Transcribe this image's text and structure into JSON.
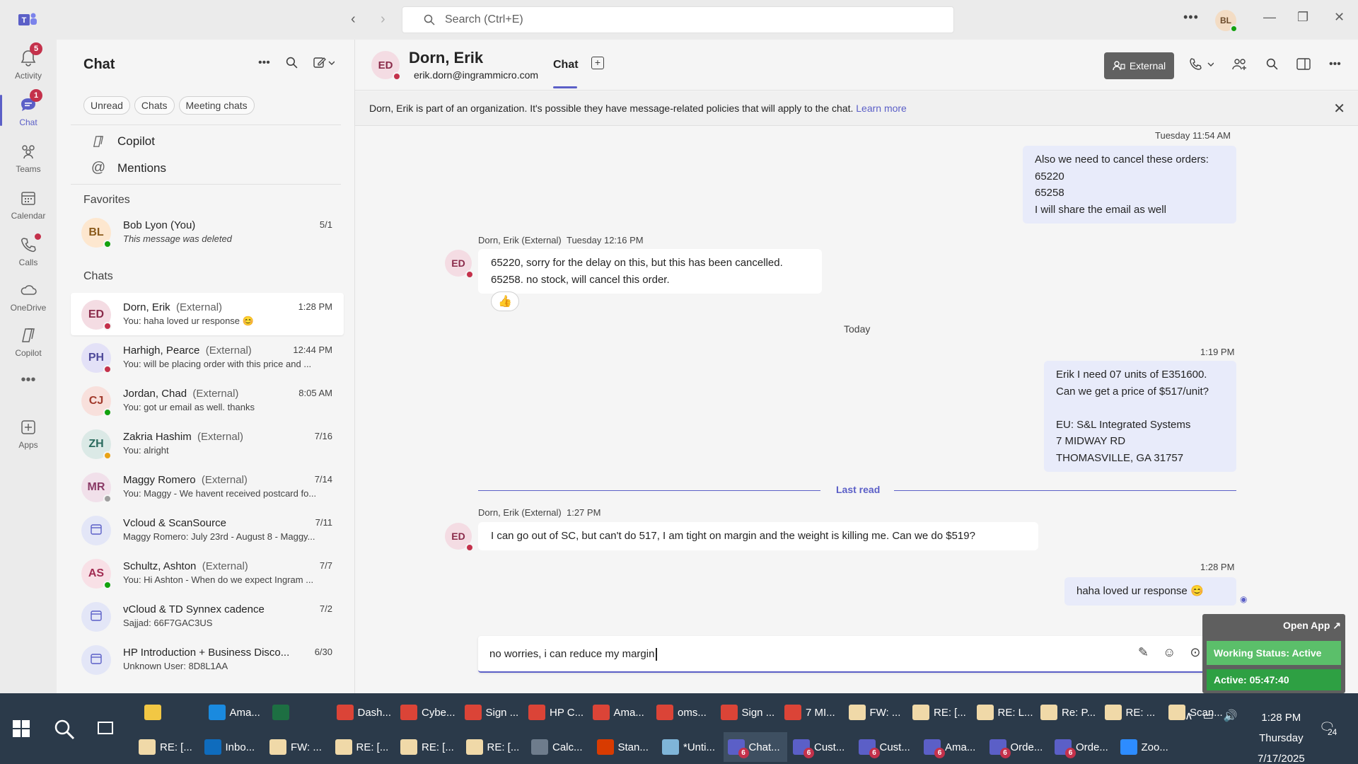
{
  "titlebar": {
    "search_placeholder": "Search (Ctrl+E)",
    "user_initials": "BL"
  },
  "rail": {
    "items": [
      {
        "label": "Activity",
        "badge": "5"
      },
      {
        "label": "Chat",
        "badge": "1"
      },
      {
        "label": "Teams"
      },
      {
        "label": "Calendar"
      },
      {
        "label": "Calls"
      },
      {
        "label": "OneDrive"
      },
      {
        "label": "Copilot"
      },
      {
        "label": "Apps"
      }
    ]
  },
  "chatlist": {
    "title": "Chat",
    "filters": [
      "Unread",
      "Chats",
      "Meeting chats"
    ],
    "copilot_label": "Copilot",
    "mentions_label": "Mentions",
    "favorites_label": "Favorites",
    "chats_label": "Chats",
    "favorites": [
      {
        "initials": "BL",
        "name": "Bob Lyon (You)",
        "ext": "",
        "time": "5/1",
        "preview": "This message was deleted",
        "bg": "#fde7cf",
        "fg": "#8a5a1a",
        "status": "#13a10e"
      }
    ],
    "chats": [
      {
        "initials": "ED",
        "name": "Dorn, Erik",
        "ext": "(External)",
        "time": "1:28 PM",
        "preview": "You: haha loved ur response 😊",
        "bg": "#f4dce3",
        "fg": "#8a2b4a",
        "status": "#c4314b"
      },
      {
        "initials": "PH",
        "name": "Harhigh, Pearce",
        "ext": "(External)",
        "time": "12:44 PM",
        "preview": "You: will be placing order with this price and ...",
        "bg": "#e3e1f7",
        "fg": "#4f4a9a",
        "status": "#c4314b"
      },
      {
        "initials": "CJ",
        "name": "Jordan, Chad",
        "ext": "(External)",
        "time": "8:05 AM",
        "preview": "You: got ur email as well. thanks",
        "bg": "#f8e0dc",
        "fg": "#a13a2c",
        "status": "#13a10e"
      },
      {
        "initials": "ZH",
        "name": "Zakria Hashim",
        "ext": "(External)",
        "time": "7/16",
        "preview": "You: alright",
        "bg": "#dbe9e6",
        "fg": "#2b6b5e",
        "status": "#e8a317"
      },
      {
        "initials": "MR",
        "name": "Maggy Romero",
        "ext": "(External)",
        "time": "7/14",
        "preview": "You: Maggy - We havent received postcard fo...",
        "bg": "#f1e0ea",
        "fg": "#8a3a66",
        "status": "#9e9e9e"
      },
      {
        "initials": "",
        "name": "Vcloud & ScanSource",
        "ext": "",
        "time": "7/11",
        "preview": "Maggy Romero: July 23rd - August 8 - Maggy...",
        "bg": "#e3e6f7",
        "fg": "#5b5fc7",
        "status": ""
      },
      {
        "initials": "AS",
        "name": "Schultz, Ashton",
        "ext": "(External)",
        "time": "7/7",
        "preview": "You: Hi Ashton -  When do we expect Ingram ...",
        "bg": "#f8e0e6",
        "fg": "#a12c52",
        "status": "#13a10e"
      },
      {
        "initials": "",
        "name": "vCloud & TD Synnex cadence",
        "ext": "",
        "time": "7/2",
        "preview": "Sajjad: 66F7GAC3US",
        "bg": "#e3e6f7",
        "fg": "#5b5fc7",
        "status": ""
      },
      {
        "initials": "",
        "name": "HP Introduction + Business Disco...",
        "ext": "",
        "time": "6/30",
        "preview": "Unknown User: 8D8L1AA",
        "bg": "#e3e6f7",
        "fg": "#5b5fc7",
        "status": ""
      }
    ]
  },
  "conversation": {
    "contact_initials": "ED",
    "contact_name": "Dorn, Erik",
    "contact_email": "erik.dorn@ingrammicro.com",
    "tab_label": "Chat",
    "external_label": "External",
    "banner_text": "Dorn, Erik is part of an organization. It's possible they have message-related policies that will apply to the chat.",
    "banner_link": "Learn more",
    "msg1_time": "Tuesday 11:54 AM",
    "msg1_lines": [
      "Also we need to cancel these orders:",
      "65220",
      "65258",
      "I will share the email as well"
    ],
    "msg2_sender": "Dorn, Erik (External)",
    "msg2_time": "Tuesday 12:16 PM",
    "msg2_lines": [
      "65220, sorry for the delay on this, but this has been cancelled.",
      "65258. no stock, will cancel this order."
    ],
    "msg2_reaction": "👍",
    "day_separator": "Today",
    "msg3_time": "1:19 PM",
    "msg3_lines": [
      "Erik I need 07 units of E351600.",
      "Can we get a price of $517/unit?",
      "",
      "EU: S&L Integrated Systems",
      "7 MIDWAY RD",
      "THOMASVILLE, GA 31757"
    ],
    "last_read": "Last read",
    "msg4_sender": "Dorn, Erik (External)",
    "msg4_time": "1:27 PM",
    "msg4_text": "I can go out of SC, but can't do 517, I am tight on margin and the weight is killing me.  Can we do $519?",
    "msg5_time": "1:28 PM",
    "msg5_text": "haha loved ur response 😊",
    "composer_text": "no worries, i can reduce my margin"
  },
  "widget": {
    "open_app": "Open App ↗",
    "working_status": "Working Status: Active",
    "active_time": "Active: 05:47:40"
  },
  "taskbar": {
    "row1": [
      {
        "label": "",
        "icon": "file-explorer-icon",
        "color": "#f2c744"
      },
      {
        "label": "Ama...",
        "icon": "edge-icon",
        "color": "#1a8adf"
      },
      {
        "label": "",
        "icon": "excel-icon",
        "color": "#1d6f42"
      },
      {
        "label": "Dash...",
        "icon": "chrome-icon",
        "color": "#db4437"
      },
      {
        "label": "Cybe...",
        "icon": "chrome-icon",
        "color": "#db4437"
      },
      {
        "label": "Sign ...",
        "icon": "chrome-icon",
        "color": "#db4437"
      },
      {
        "label": "HP C...",
        "icon": "chrome-icon",
        "color": "#db4437"
      },
      {
        "label": "Ama...",
        "icon": "chrome-icon",
        "color": "#db4437"
      },
      {
        "label": "oms...",
        "icon": "chrome-icon",
        "color": "#db4437"
      },
      {
        "label": "Sign ...",
        "icon": "chrome-icon",
        "color": "#db4437"
      },
      {
        "label": "7 MI...",
        "icon": "chrome-icon",
        "color": "#db4437"
      },
      {
        "label": "FW: ...",
        "icon": "mail-icon",
        "color": "#f0d9a8"
      },
      {
        "label": "RE: [...",
        "icon": "mail-icon",
        "color": "#f0d9a8"
      },
      {
        "label": "RE: L...",
        "icon": "mail-icon",
        "color": "#f0d9a8"
      },
      {
        "label": "Re: P...",
        "icon": "mail-icon",
        "color": "#f0d9a8"
      },
      {
        "label": "RE: ...",
        "icon": "mail-icon",
        "color": "#f0d9a8"
      },
      {
        "label": "Scan...",
        "icon": "mail-icon",
        "color": "#f0d9a8"
      }
    ],
    "row2": [
      {
        "label": "RE: [...",
        "icon": "mail-icon",
        "color": "#f0d9a8",
        "count": ""
      },
      {
        "label": "Inbo...",
        "icon": "outlook-icon",
        "color": "#0f6cbd",
        "count": ""
      },
      {
        "label": "FW: ...",
        "icon": "mail-icon",
        "color": "#f0d9a8",
        "count": ""
      },
      {
        "label": "RE: [...",
        "icon": "mail-icon",
        "color": "#f0d9a8",
        "count": ""
      },
      {
        "label": "RE: [...",
        "icon": "mail-icon",
        "color": "#f0d9a8",
        "count": ""
      },
      {
        "label": "RE: [...",
        "icon": "mail-icon",
        "color": "#f0d9a8",
        "count": ""
      },
      {
        "label": "Calc...",
        "icon": "calculator-icon",
        "color": "#6e7c8c",
        "count": ""
      },
      {
        "label": "Stan...",
        "icon": "pdf-icon",
        "color": "#d83b01",
        "count": ""
      },
      {
        "label": "*Unti...",
        "icon": "paint-icon",
        "color": "#7fb5d8",
        "count": ""
      },
      {
        "label": "Chat...",
        "icon": "teams-icon",
        "color": "#5b5fc7",
        "count": "6"
      },
      {
        "label": "Cust...",
        "icon": "teams-icon",
        "color": "#5b5fc7",
        "count": "6"
      },
      {
        "label": "Cust...",
        "icon": "teams-icon",
        "color": "#5b5fc7",
        "count": "6"
      },
      {
        "label": "Ama...",
        "icon": "teams-icon",
        "color": "#5b5fc7",
        "count": "6"
      },
      {
        "label": "Orde...",
        "icon": "teams-icon",
        "color": "#5b5fc7",
        "count": "6"
      },
      {
        "label": "Orde...",
        "icon": "teams-icon",
        "color": "#5b5fc7",
        "count": "6"
      },
      {
        "label": "Zoo...",
        "icon": "zoom-icon",
        "color": "#2d8cff",
        "count": ""
      }
    ],
    "time": "1:28 PM",
    "day": "Thursday",
    "date": "7/17/2025",
    "notif_count": "24"
  }
}
